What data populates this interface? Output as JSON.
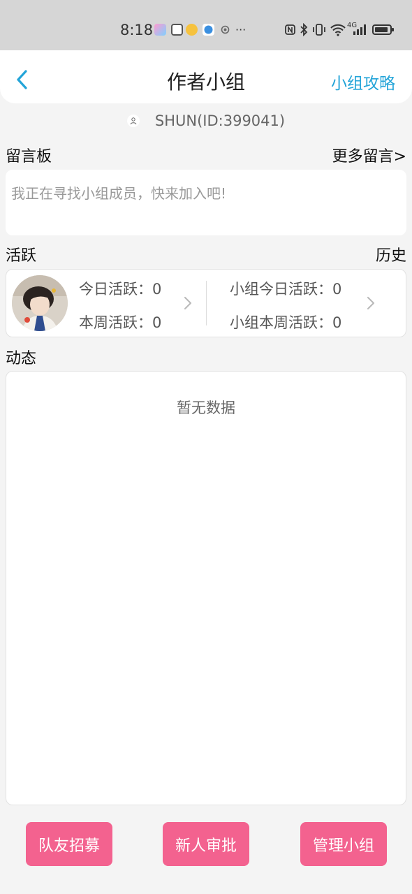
{
  "status_bar": {
    "time": "8:18",
    "network": "4G",
    "more": "···",
    "icons": [
      "app-icon",
      "app-icon",
      "weibo-icon",
      "browser-icon",
      "gear-icon",
      "nfc-icon",
      "bluetooth-icon",
      "vibrate-icon",
      "wifi-icon",
      "signal-icon",
      "battery-icon"
    ]
  },
  "header": {
    "title": "作者小组",
    "guide_link": "小组攻略"
  },
  "user": {
    "id_text": "SHUN(ID:399041)"
  },
  "message_board": {
    "label": "留言板",
    "more_link": "更多留言>",
    "message": "我正在寻找小组成员，快来加入吧!"
  },
  "activity": {
    "label": "活跃",
    "history_link": "历史",
    "today_label": "今日活跃：",
    "today_value": "0",
    "week_label": "本周活跃：",
    "week_value": "0",
    "group_today_label": "小组今日活跃：",
    "group_today_value": "0",
    "group_week_label": "小组本周活跃：",
    "group_week_value": "0"
  },
  "feed": {
    "label": "动态",
    "empty_text": "暂无数据"
  },
  "buttons": {
    "recruit": "队友招募",
    "approve": "新人审批",
    "manage": "管理小组"
  },
  "colors": {
    "accent_blue": "#23a4d8",
    "button_pink": "#f3628f",
    "background": "#f4f4f4"
  }
}
